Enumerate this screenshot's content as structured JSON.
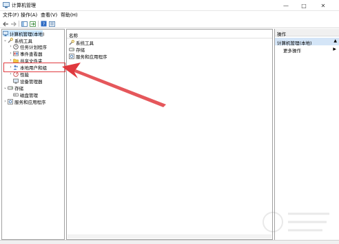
{
  "window": {
    "title": "计算机管理",
    "icon": "computer-management-icon",
    "controls": [
      "minimize-icon",
      "maximize-icon",
      "close-icon"
    ]
  },
  "menubar": {
    "items": [
      {
        "label": "文件(F)"
      },
      {
        "label": "操作(A)"
      },
      {
        "label": "查看(V)"
      },
      {
        "label": "帮助(H)"
      }
    ]
  },
  "toolbar": {
    "buttons": [
      "back-icon",
      "forward-icon",
      "show-tree-icon",
      "export-list-icon",
      "help-icon",
      "properties-icon"
    ]
  },
  "tree": {
    "items": [
      {
        "label": "计算机管理(本地)",
        "level": 0,
        "expander": "",
        "icon": "computer-icon",
        "selected": true
      },
      {
        "label": "系统工具",
        "level": 1,
        "expander": "⌄",
        "icon": "tools-icon"
      },
      {
        "label": "任务计划程序",
        "level": 2,
        "expander": "›",
        "icon": "task-scheduler-icon"
      },
      {
        "label": "事件查看器",
        "level": 2,
        "expander": "›",
        "icon": "event-viewer-icon"
      },
      {
        "label": "共享文件夹",
        "level": 2,
        "expander": "›",
        "icon": "shared-folder-icon"
      },
      {
        "label": "本地用户和组",
        "level": 2,
        "expander": "›",
        "icon": "users-icon"
      },
      {
        "label": "性能",
        "level": 2,
        "expander": "›",
        "icon": "performance-icon"
      },
      {
        "label": "设备管理器",
        "level": 2,
        "expander": "",
        "icon": "device-manager-icon"
      },
      {
        "label": "存储",
        "level": 1,
        "expander": "⌄",
        "icon": "storage-icon"
      },
      {
        "label": "磁盘管理",
        "level": 2,
        "expander": "",
        "icon": "disk-icon"
      },
      {
        "label": "服务和应用程序",
        "level": 1,
        "expander": "›",
        "icon": "services-icon"
      }
    ]
  },
  "list": {
    "column_header": "名称",
    "rows": [
      {
        "label": "系统工具",
        "icon": "tools-icon"
      },
      {
        "label": "存储",
        "icon": "storage-icon"
      },
      {
        "label": "服务和应用程序",
        "icon": "services-icon"
      }
    ]
  },
  "actions": {
    "header": "操作",
    "section": "计算机管理(本地)",
    "items": [
      {
        "label": "更多操作"
      }
    ]
  },
  "annotation": {
    "highlight_color": "#e0393e",
    "target": "本地用户和组"
  },
  "colors": {
    "selection": "#cce8ff",
    "action_section": "#d4e5f7",
    "annotation": "#e0393e"
  }
}
